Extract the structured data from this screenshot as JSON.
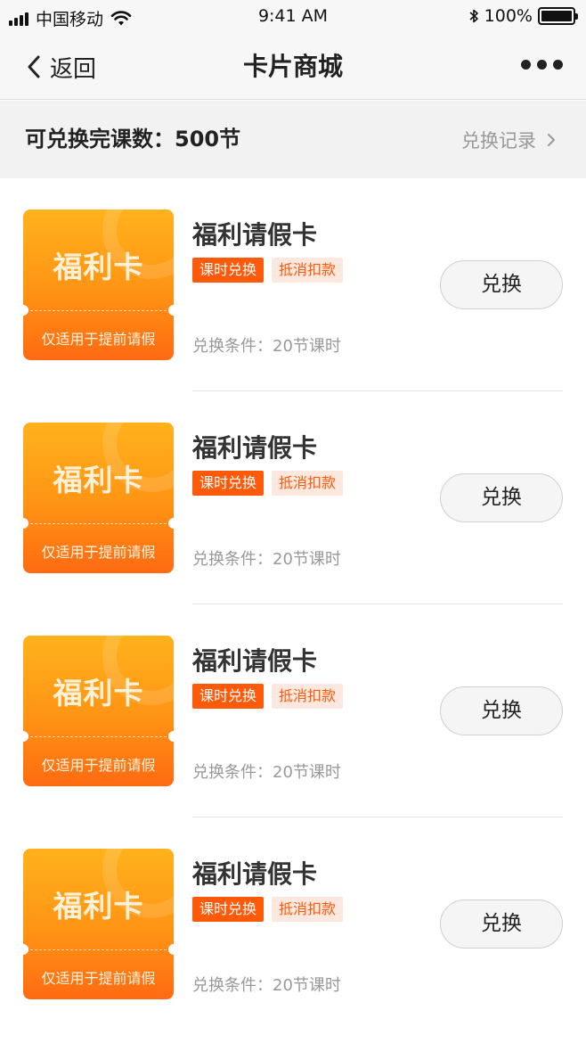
{
  "status_bar": {
    "carrier": "中国移动",
    "time": "9:41 AM",
    "battery": "100%"
  },
  "nav": {
    "back_label": "返回",
    "title": "卡片商城"
  },
  "summary": {
    "text": "可兑换完课数：500节",
    "record_label": "兑换记录"
  },
  "items": [
    {
      "card_title": "福利卡",
      "card_subtitle": "仅适用于提前请假",
      "title": "福利请假卡",
      "tags": [
        "课时兑换",
        "抵消扣款"
      ],
      "condition": "兑换条件：20节课时",
      "button": "兑换"
    },
    {
      "card_title": "福利卡",
      "card_subtitle": "仅适用于提前请假",
      "title": "福利请假卡",
      "tags": [
        "课时兑换",
        "抵消扣款"
      ],
      "condition": "兑换条件：20节课时",
      "button": "兑换"
    },
    {
      "card_title": "福利卡",
      "card_subtitle": "仅适用于提前请假",
      "title": "福利请假卡",
      "tags": [
        "课时兑换",
        "抵消扣款"
      ],
      "condition": "兑换条件：20节课时",
      "button": "兑换"
    },
    {
      "card_title": "福利卡",
      "card_subtitle": "仅适用于提前请假",
      "title": "福利请假卡",
      "tags": [
        "课时兑换",
        "抵消扣款"
      ],
      "condition": "兑换条件：20节课时",
      "button": "兑换"
    }
  ],
  "colors": {
    "accent": "#ff5a0a",
    "card_top": "#ffb21c",
    "card_bottom": "#ff6a12",
    "tag_light_bg": "#fde8df"
  },
  "icons": {
    "signal": "signal-icon",
    "wifi": "wifi-icon",
    "bluetooth": "bluetooth-icon",
    "battery": "battery-icon",
    "back": "chevron-left-icon",
    "more": "more-dots-icon",
    "record": "chevron-right-icon"
  }
}
